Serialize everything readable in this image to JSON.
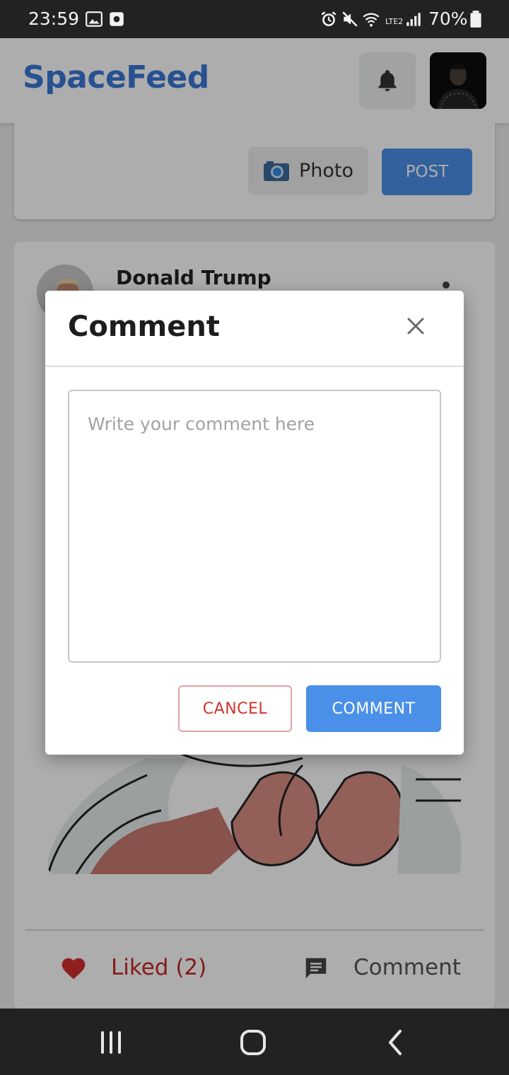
{
  "status_bar": {
    "time": "23:59",
    "battery": "70%",
    "network_label": "LTE2"
  },
  "app": {
    "title": "SpaceFeed",
    "accent_color": "#3a78d6"
  },
  "composer": {
    "photo_label": "Photo",
    "post_label": "POST"
  },
  "post": {
    "author": "Donald Trump",
    "like_label": "Liked (2)",
    "comment_label": "Comment"
  },
  "dialog": {
    "title": "Comment",
    "placeholder": "Write your comment here",
    "cancel_label": "CANCEL",
    "submit_label": "COMMENT"
  },
  "icons": [
    "image-icon",
    "screenshot-icon",
    "alarm-icon",
    "mute-icon",
    "wifi-icon",
    "signal-icon",
    "battery-icon",
    "bell-icon",
    "camera-icon",
    "heart-icon",
    "comment-icon",
    "close-icon",
    "recent-apps-icon",
    "home-icon",
    "back-icon"
  ]
}
